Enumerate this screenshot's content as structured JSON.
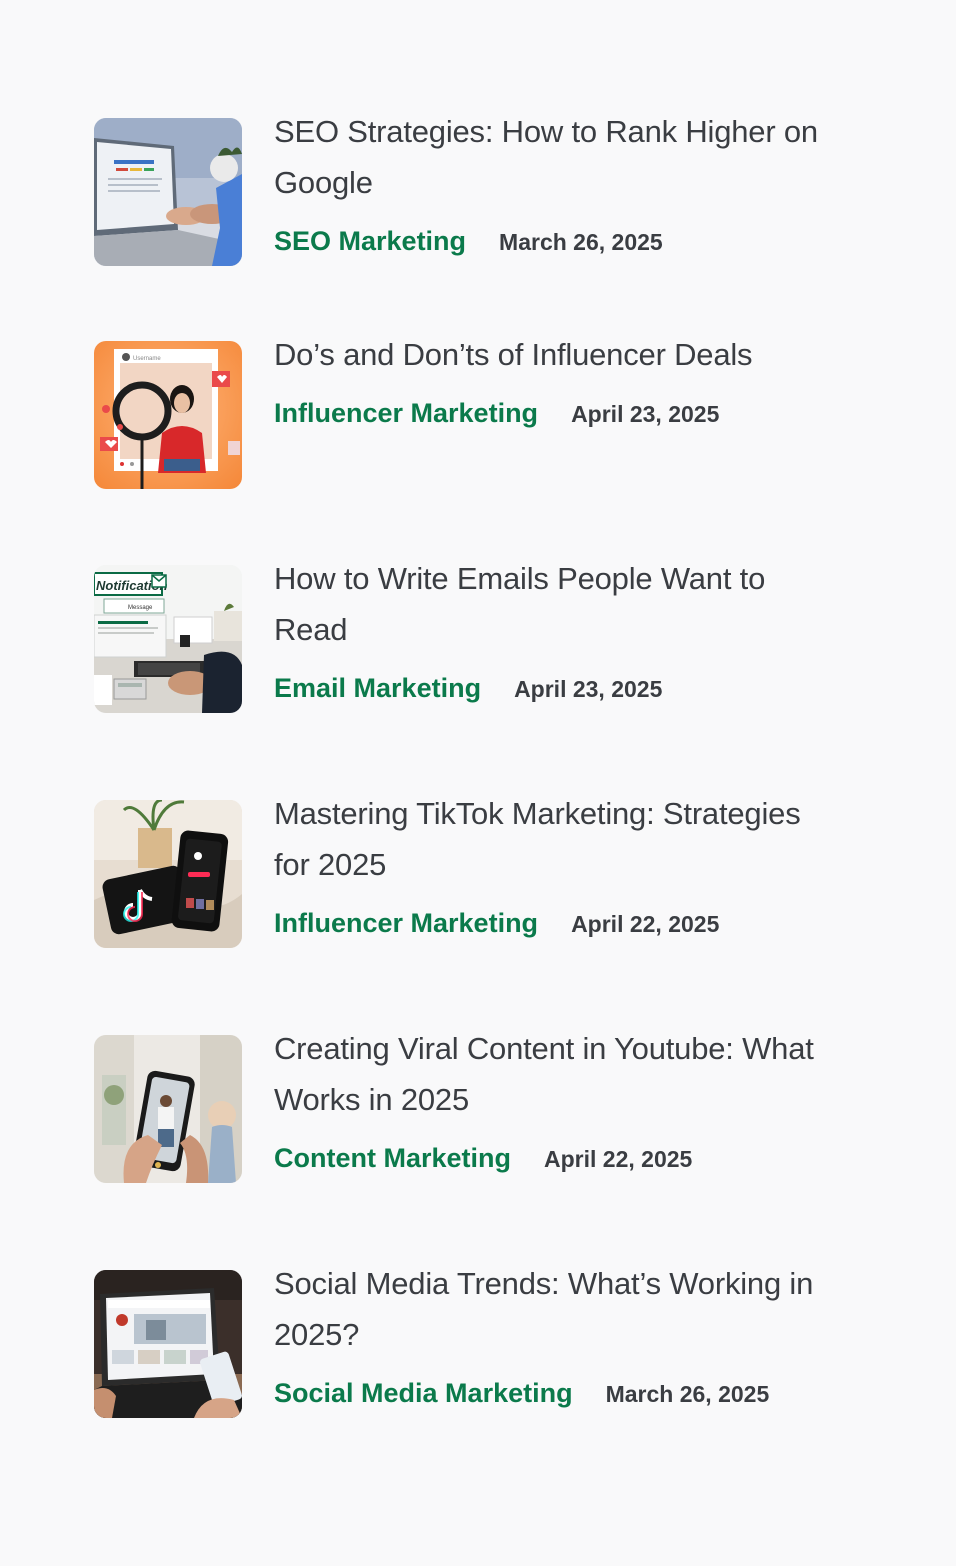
{
  "colors": {
    "background": "#f9f9fa",
    "title": "#3a3d42",
    "category": "#0b7a4b",
    "date": "#3a3d42"
  },
  "posts": [
    {
      "title": "SEO Strategies: How to Rank Higher on Google",
      "category": "SEO Marketing",
      "date": "March 26, 2025"
    },
    {
      "title": "Do’s and Don’ts of Influencer Deals",
      "category": "Influencer Marketing",
      "date": "April 23, 2025",
      "thumb_text": {
        "username": "Username"
      }
    },
    {
      "title": "How to Write Emails People Want to Read",
      "category": "Email Marketing",
      "date": "April 23, 2025",
      "thumb_text": {
        "notification": "Notification",
        "message": "Message"
      }
    },
    {
      "title": "Mastering TikTok Marketing: Strategies for 2025",
      "category": "Influencer Marketing",
      "date": "April 22, 2025"
    },
    {
      "title": "Creating Viral Content in Youtube: What Works in 2025",
      "category": "Content Marketing",
      "date": "April 22, 2025"
    },
    {
      "title": "Social Media Trends: What’s Working in 2025?",
      "category": "Social Media Marketing",
      "date": "March 26, 2025"
    }
  ]
}
